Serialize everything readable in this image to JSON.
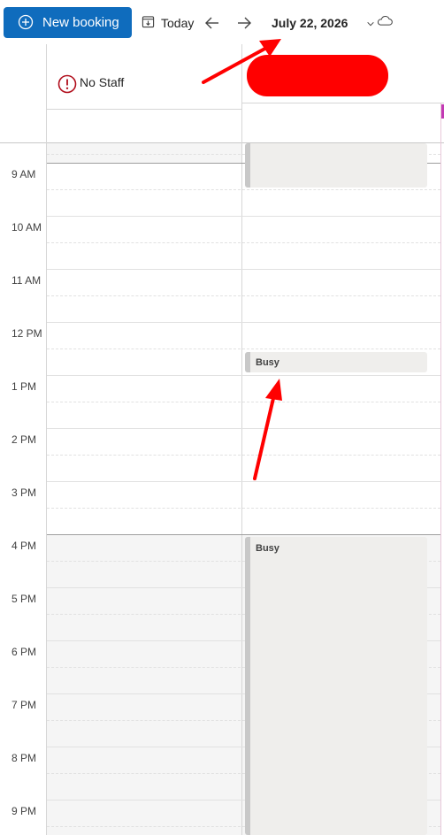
{
  "toolbar": {
    "new_booking_label": "New booking",
    "today_label": "Today",
    "date_label": "July 22, 2026"
  },
  "columns": {
    "no_staff_label": "No Staff"
  },
  "hours": [
    "9 AM",
    "10 AM",
    "11 AM",
    "12 PM",
    "1 PM",
    "2 PM",
    "3 PM",
    "4 PM",
    "5 PM",
    "6 PM",
    "7 PM",
    "8 PM",
    "9 PM"
  ],
  "events": [
    {
      "label": ""
    },
    {
      "label": "Busy"
    },
    {
      "label": "Busy"
    }
  ],
  "colors": {
    "accent": "#0f6cbd",
    "annotation": "#ff0000",
    "warning": "#c4314b"
  }
}
